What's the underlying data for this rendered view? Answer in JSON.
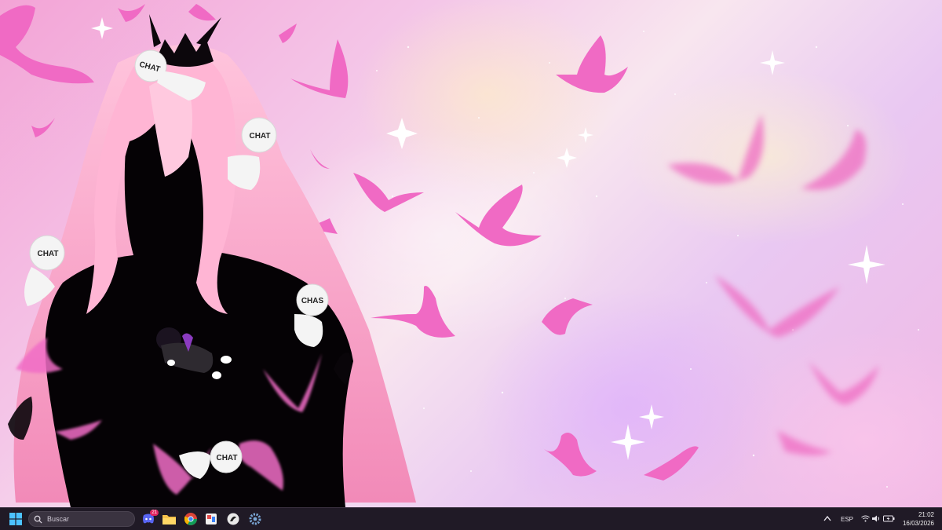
{
  "wallpaper": {
    "bubble_labels": [
      "CHAT",
      "CHAT",
      "CHAT",
      "CHAS",
      "CHAT"
    ]
  },
  "taskbar": {
    "search_placeholder": "Buscar",
    "pinned": [
      {
        "name": "discord-icon",
        "badge": "21"
      },
      {
        "name": "file-explorer-icon"
      },
      {
        "name": "chrome-icon"
      },
      {
        "name": "paint-app-icon"
      },
      {
        "name": "clip-studio-icon"
      },
      {
        "name": "settings-icon"
      }
    ],
    "tray": {
      "language": "ESP",
      "time": "21:02",
      "date": "16/03/2026"
    }
  }
}
